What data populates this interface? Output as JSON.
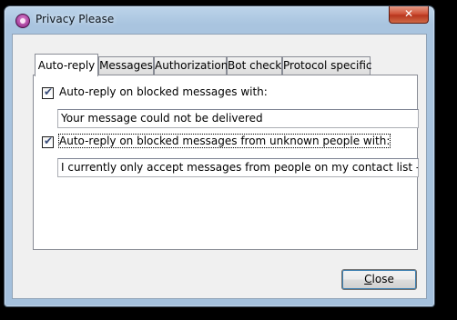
{
  "window": {
    "title": "Privacy Please",
    "close_glyph": "✕"
  },
  "tabs": [
    {
      "label": "Auto-reply",
      "active": true
    },
    {
      "label": "Messages",
      "active": false
    },
    {
      "label": "Authorization",
      "active": false
    },
    {
      "label": "Bot check",
      "active": false
    },
    {
      "label": "Protocol specific",
      "active": false
    }
  ],
  "autoreply": {
    "blocked": {
      "checked": true,
      "label": "Auto-reply on blocked messages with:",
      "value": "Your message could not be delivered"
    },
    "unknown": {
      "checked": true,
      "label": "Auto-reply on blocked messages from unknown people with:",
      "value": "I currently only accept messages from people on my contact list - please re"
    }
  },
  "footer": {
    "close_mnemonic": "C",
    "close_rest": "lose"
  },
  "colors": {
    "titlebar": "#a9c4df",
    "close_button": "#c9452b",
    "focus_ring": "#3c7fb1"
  }
}
